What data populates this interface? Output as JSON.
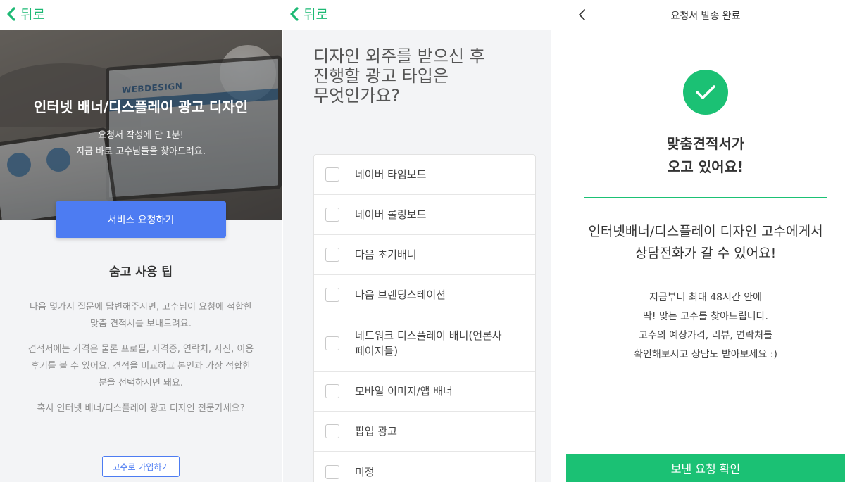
{
  "panel1": {
    "back_label": "뒤로",
    "hero": {
      "screen_text": "WEBDESIGN",
      "title": "인터넷 배너/디스플레이 광고 디자인",
      "subtitle_line1": "요청서 작성에 단 1분!",
      "subtitle_line2": "지금 바로 고수님들을 찾아드려요."
    },
    "request_button": "서비스 요청하기",
    "tips": {
      "title": "숨고 사용 팁",
      "paragraph1_line1": "다음 몇가지 질문에 답변해주시면, 고수님이 요청에 적합한",
      "paragraph1_line2": "맞춤 견적서를 보내드려요.",
      "paragraph2_line1": "견적서에는 가격은 물론 프로필, 자격증, 연락처, 사진, 이용",
      "paragraph2_line2": "후기를 볼 수 있어요. 견적을 비교하고 본인과 가장 적합한",
      "paragraph2_line3": "분을 선택하시면 돼요.",
      "paragraph3": "혹시 인터넷 배너/디스플레이 광고 디자인 전문가세요?"
    },
    "signup_button": "고수로 가입하기"
  },
  "panel2": {
    "back_label": "뒤로",
    "question_lines": [
      "디자인 외주를 받으신 후",
      "진행할 광고 타입은",
      "무엇인가요?"
    ],
    "options": [
      {
        "line1": "네이버 타임보드",
        "line2": "",
        "checked": false
      },
      {
        "line1": "네이버 롤링보드",
        "line2": "",
        "checked": false
      },
      {
        "line1": "다음 초기배너",
        "line2": "",
        "checked": false
      },
      {
        "line1": "다음 브랜딩스테이션",
        "line2": "",
        "checked": false
      },
      {
        "line1": "네트워크 디스플레이 배너(언론사",
        "line2": "페이지들)",
        "checked": false
      },
      {
        "line1": "모바일 이미지/앱 배너",
        "line2": "",
        "checked": false
      },
      {
        "line1": "팝업 광고",
        "line2": "",
        "checked": false
      },
      {
        "line1": "미정",
        "line2": "",
        "checked": false
      }
    ]
  },
  "panel3": {
    "header_title": "요청서 발송 완료",
    "done_title_line1": "맞춤견적서가",
    "done_title_line2": "오고 있어요!",
    "message_line1": "인터넷배너/디스플레이 디자인 고수에게서",
    "message_line2": "상담전화가 갈 수 있어요!",
    "info_lines": [
      "지금부터 최대 48시간 안에",
      "딱! 맞는 고수를 찾아드립니다.",
      "고수의 예상가격, 리뷰, 연락처를",
      "확인해보시고 상담도 받아보세요 :)"
    ],
    "confirm_button": "보낸 요청 확인"
  },
  "colors": {
    "green": "#1bc174",
    "back_green": "#1db974",
    "blue": "#4d7cf2",
    "gray_bg": "#f3f4f6"
  }
}
